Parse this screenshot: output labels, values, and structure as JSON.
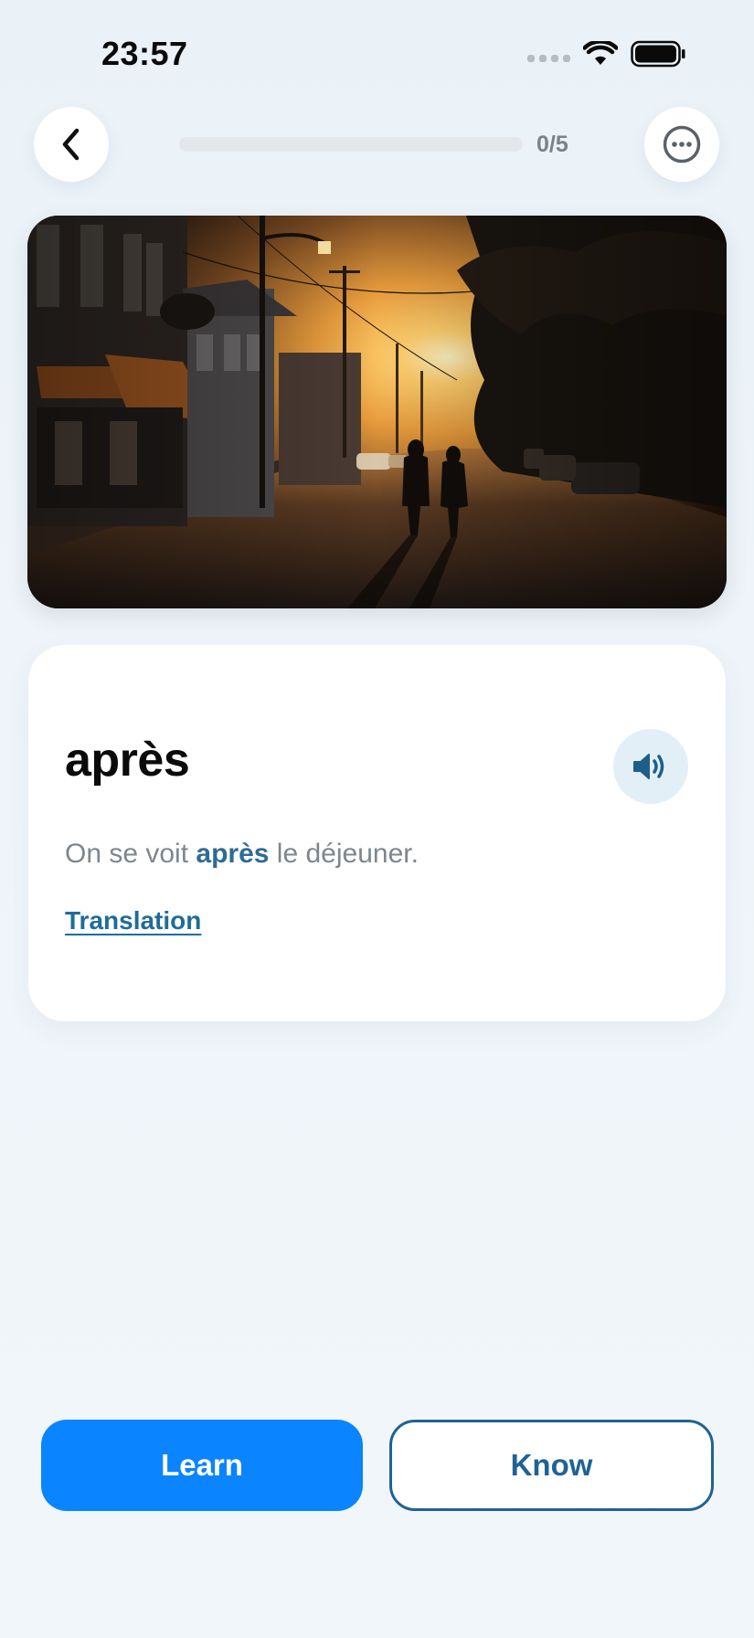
{
  "status_bar": {
    "time": "23:57"
  },
  "header": {
    "progress_text": "0/5",
    "progress_fraction": 0,
    "back_icon": "chevron-left-icon",
    "more_icon": "ellipsis-circle-icon"
  },
  "hero": {
    "image_description": "photo"
  },
  "card": {
    "word": "après",
    "sentence_before": "On se voit ",
    "sentence_highlight": "après",
    "sentence_after": " le déjeuner.",
    "translation_label": "Translation",
    "audio_icon": "speaker-icon"
  },
  "actions": {
    "learn_label": "Learn",
    "know_label": "Know"
  },
  "colors": {
    "accent": "#0a84ff",
    "secondary": "#1f6393",
    "highlight": "#2d6c93"
  }
}
